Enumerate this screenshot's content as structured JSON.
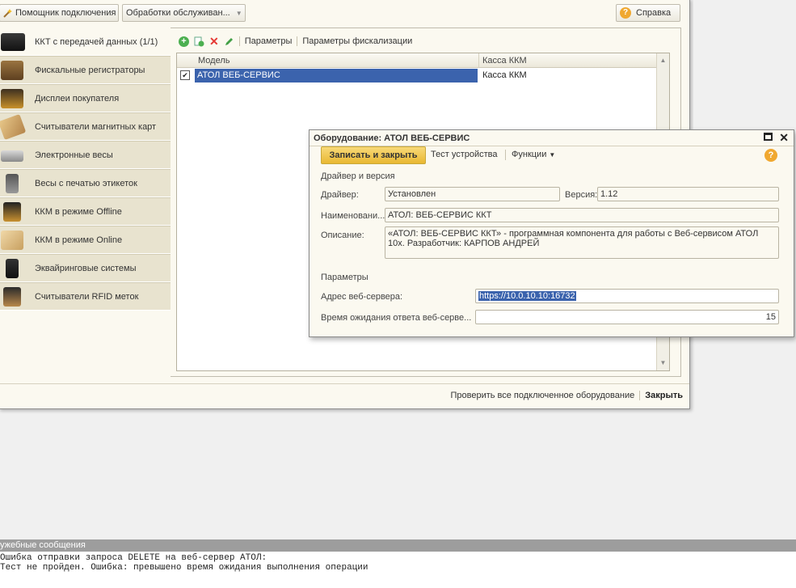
{
  "toolbar": {
    "connection_assistant": "Помощник подключения",
    "service_processing": "Обработки обслуживан...",
    "help": "Справка"
  },
  "sidebar": {
    "items": [
      {
        "label": "ККТ с передачей данных (1/1)",
        "icon": "cash-register-icon"
      },
      {
        "label": "Фискальные регистраторы",
        "icon": "fiscal-printer-icon"
      },
      {
        "label": "Дисплеи покупателя",
        "icon": "customer-display-icon"
      },
      {
        "label": "Считыватели магнитных карт",
        "icon": "card-reader-icon"
      },
      {
        "label": "Электронные весы",
        "icon": "scales-icon"
      },
      {
        "label": "Весы с печатью этикеток",
        "icon": "label-scales-icon"
      },
      {
        "label": "ККМ в режиме Offline",
        "icon": "offline-kkm-icon"
      },
      {
        "label": "ККМ в режиме Online",
        "icon": "online-kkm-icon"
      },
      {
        "label": "Эквайринговые системы",
        "icon": "acquiring-terminal-icon"
      },
      {
        "label": "Считыватели RFID меток",
        "icon": "rfid-reader-icon"
      }
    ]
  },
  "grid_toolbar": {
    "parameters": "Параметры",
    "fiscal_parameters": "Параметры фискализации"
  },
  "grid": {
    "columns": [
      "Модель",
      "Касса ККМ"
    ],
    "rows": [
      {
        "checked": true,
        "model": "АТОЛ ВЕБ-СЕРВИС",
        "cash_register": "Касса ККМ"
      }
    ]
  },
  "bottom_bar": {
    "check_all": "Проверить все подключенное оборудование",
    "close": "Закрыть"
  },
  "dialog": {
    "title": "Оборудование: АТОЛ ВЕБ-СЕРВИС",
    "save_and_close": "Записать и закрыть",
    "device_test": "Тест устройства",
    "functions": "Функции",
    "section_driver": "Драйвер и версия",
    "driver_label": "Драйвер:",
    "driver_value": "Установлен",
    "version_label": "Версия:",
    "version_value": "1.12",
    "name_label": "Наименовани...",
    "name_value": "АТОЛ: ВЕБ-СЕРВИС ККТ",
    "description_label": "Описание:",
    "description_value": "«АТОЛ: ВЕБ-СЕРВИС ККТ» - программная компонента для работы с Веб-сервисом АТОЛ 10х. Разработчик: КАРПОВ АНДРЕЙ",
    "section_params": "Параметры",
    "web_server_label": "Адрес веб-сервера:",
    "web_server_value": "https://10.0.10.10:16732",
    "timeout_label": "Время ожидания ответа веб-серве...",
    "timeout_value": "15"
  },
  "messages": {
    "header": "ужебные сообщения",
    "lines": [
      "Ошибка отправки запроса DELETE на веб-сервер АТОЛ:",
      "Тест не пройден. Ошибка: превышено время ожидания выполнения операции"
    ]
  },
  "colors": {
    "selection": "#3b63ad",
    "save_button": "#f2c94c",
    "sidebar_bg": "#e8e3cf",
    "window_bg": "#fbf9f0"
  }
}
